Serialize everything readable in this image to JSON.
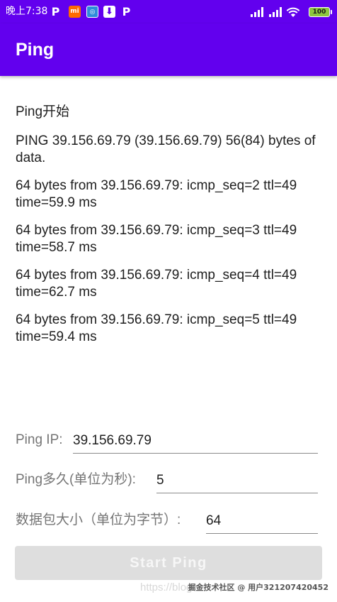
{
  "status_bar": {
    "time": "晚上7:38",
    "notifications": [
      {
        "icon": "parking-p-icon",
        "glyph": "P"
      },
      {
        "icon": "mi-icon",
        "glyph": "mi"
      },
      {
        "icon": "app-icon",
        "glyph": "◎"
      },
      {
        "icon": "download-icon",
        "glyph": "⬇"
      },
      {
        "icon": "parking-p-icon",
        "glyph": "P"
      }
    ],
    "battery": "100"
  },
  "app_bar": {
    "title": "Ping"
  },
  "log": {
    "lines": [
      "Ping开始",
      "PING 39.156.69.79 (39.156.69.79) 56(84) bytes of data.",
      "64 bytes from 39.156.69.79: icmp_seq=2 ttl=49 time=59.9 ms",
      "64 bytes from 39.156.69.79: icmp_seq=3 ttl=49 time=58.7 ms",
      "64 bytes from 39.156.69.79: icmp_seq=4 ttl=49 time=62.7 ms",
      "64 bytes from 39.156.69.79: icmp_seq=5 ttl=49 time=59.4 ms"
    ]
  },
  "form": {
    "ip_label": "Ping IP:",
    "ip_value": "39.156.69.79",
    "duration_label": "Ping多久(单位为秒):",
    "duration_value": "5",
    "size_label": "数据包大小（单位为字节）:",
    "size_value": "64",
    "start_label": "Start Ping"
  },
  "watermark": {
    "url": "https://blog.",
    "text": "掘金技术社区 @ 用户321207420452"
  },
  "colors": {
    "primary": "#6200ee",
    "button_disabled": "#dedede"
  }
}
